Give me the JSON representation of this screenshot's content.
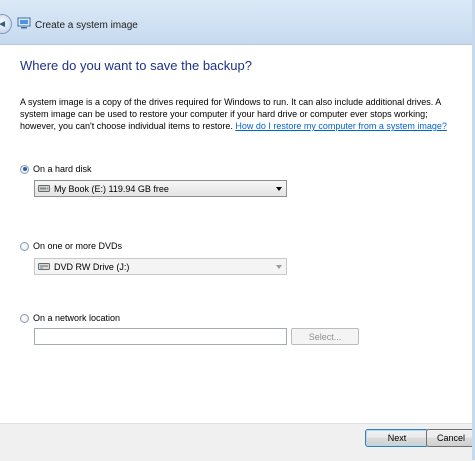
{
  "window": {
    "title": "Create a system image"
  },
  "page": {
    "heading": "Where do you want to save the backup?",
    "description": "A system image is a copy of the drives required for Windows to run. It can also include additional drives. A system image can be used to restore your computer if your hard drive or computer ever stops working; however, you can't choose individual items to restore. ",
    "help_link": "How do I restore my computer from a system image?"
  },
  "options": {
    "hard_disk": {
      "label": "On a hard disk",
      "selected": true,
      "value": "My Book (E:)  119.94 GB free"
    },
    "dvd": {
      "label": "On one or more DVDs",
      "selected": false,
      "value": "DVD RW Drive (J:)"
    },
    "network": {
      "label": "On a network location",
      "selected": false,
      "value": "",
      "select_label": "Select..."
    }
  },
  "footer": {
    "next_label": "Next",
    "cancel_label": "Cancel"
  },
  "icons": {
    "back": "back-arrow-icon",
    "title": "backup-icon",
    "hard_disk": "hard-drive-icon",
    "dvd": "dvd-drive-icon"
  },
  "colors": {
    "heading": "#1e3287",
    "link": "#0066cc",
    "titlebar": "#cfe0f2",
    "footer": "#f0f0f0"
  }
}
